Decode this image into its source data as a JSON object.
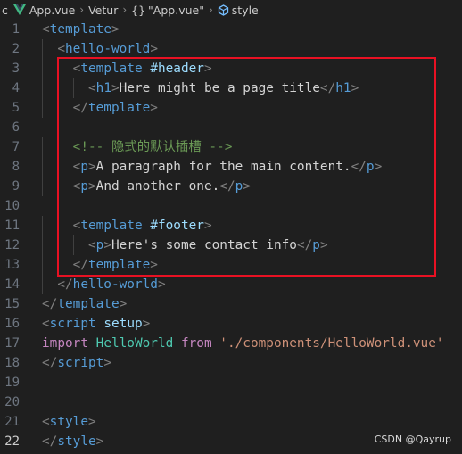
{
  "breadcrumb": {
    "items": [
      "c",
      "App.vue",
      "Vetur",
      "\"App.vue\"",
      "style"
    ],
    "braces": "{}",
    "separator": "›"
  },
  "lines": [
    {
      "n": "1",
      "tokens": [
        [
          "bracket",
          "<"
        ],
        [
          "tag",
          "template"
        ],
        [
          "bracket",
          ">"
        ]
      ]
    },
    {
      "n": "2",
      "tokens": [
        [
          "text",
          "  "
        ],
        [
          "bracket",
          "<"
        ],
        [
          "tag",
          "hello-world"
        ],
        [
          "bracket",
          ">"
        ]
      ]
    },
    {
      "n": "3",
      "tokens": [
        [
          "text",
          "    "
        ],
        [
          "bracket",
          "<"
        ],
        [
          "tag",
          "template"
        ],
        [
          "text",
          " "
        ],
        [
          "attr",
          "#header"
        ],
        [
          "bracket",
          ">"
        ]
      ]
    },
    {
      "n": "4",
      "tokens": [
        [
          "text",
          "      "
        ],
        [
          "bracket",
          "<"
        ],
        [
          "tag",
          "h1"
        ],
        [
          "bracket",
          ">"
        ],
        [
          "text",
          "Here might be a page title"
        ],
        [
          "bracket",
          "</"
        ],
        [
          "tag",
          "h1"
        ],
        [
          "bracket",
          ">"
        ]
      ]
    },
    {
      "n": "5",
      "tokens": [
        [
          "text",
          "    "
        ],
        [
          "bracket",
          "</"
        ],
        [
          "tag",
          "template"
        ],
        [
          "bracket",
          ">"
        ]
      ]
    },
    {
      "n": "6",
      "tokens": []
    },
    {
      "n": "7",
      "tokens": [
        [
          "text",
          "    "
        ],
        [
          "comment",
          "<!-- 隐式的默认插槽 -->"
        ]
      ]
    },
    {
      "n": "8",
      "tokens": [
        [
          "text",
          "    "
        ],
        [
          "bracket",
          "<"
        ],
        [
          "tag",
          "p"
        ],
        [
          "bracket",
          ">"
        ],
        [
          "text",
          "A paragraph for the main content."
        ],
        [
          "bracket",
          "</"
        ],
        [
          "tag",
          "p"
        ],
        [
          "bracket",
          ">"
        ]
      ]
    },
    {
      "n": "9",
      "tokens": [
        [
          "text",
          "    "
        ],
        [
          "bracket",
          "<"
        ],
        [
          "tag",
          "p"
        ],
        [
          "bracket",
          ">"
        ],
        [
          "text",
          "And another one."
        ],
        [
          "bracket",
          "</"
        ],
        [
          "tag",
          "p"
        ],
        [
          "bracket",
          ">"
        ]
      ]
    },
    {
      "n": "10",
      "tokens": []
    },
    {
      "n": "11",
      "tokens": [
        [
          "text",
          "    "
        ],
        [
          "bracket",
          "<"
        ],
        [
          "tag",
          "template"
        ],
        [
          "text",
          " "
        ],
        [
          "attr",
          "#footer"
        ],
        [
          "bracket",
          ">"
        ]
      ]
    },
    {
      "n": "12",
      "tokens": [
        [
          "text",
          "      "
        ],
        [
          "bracket",
          "<"
        ],
        [
          "tag",
          "p"
        ],
        [
          "bracket",
          ">"
        ],
        [
          "text",
          "Here's some contact info"
        ],
        [
          "bracket",
          "</"
        ],
        [
          "tag",
          "p"
        ],
        [
          "bracket",
          ">"
        ]
      ]
    },
    {
      "n": "13",
      "tokens": [
        [
          "text",
          "    "
        ],
        [
          "bracket",
          "</"
        ],
        [
          "tag",
          "template"
        ],
        [
          "bracket",
          ">"
        ]
      ]
    },
    {
      "n": "14",
      "tokens": [
        [
          "text",
          "  "
        ],
        [
          "bracket",
          "</"
        ],
        [
          "tag",
          "hello-world"
        ],
        [
          "bracket",
          ">"
        ]
      ]
    },
    {
      "n": "15",
      "tokens": [
        [
          "bracket",
          "</"
        ],
        [
          "tag",
          "template"
        ],
        [
          "bracket",
          ">"
        ]
      ]
    },
    {
      "n": "16",
      "tokens": [
        [
          "bracket",
          "<"
        ],
        [
          "tag",
          "script"
        ],
        [
          "text",
          " "
        ],
        [
          "attr",
          "setup"
        ],
        [
          "bracket",
          ">"
        ]
      ]
    },
    {
      "n": "17",
      "tokens": [
        [
          "keyword",
          "import"
        ],
        [
          "text",
          " "
        ],
        [
          "class",
          "HelloWorld"
        ],
        [
          "text",
          " "
        ],
        [
          "keyword",
          "from"
        ],
        [
          "text",
          " "
        ],
        [
          "string",
          "'./components/HelloWorld.vue'"
        ]
      ]
    },
    {
      "n": "18",
      "tokens": [
        [
          "bracket",
          "</"
        ],
        [
          "tag",
          "script"
        ],
        [
          "bracket",
          ">"
        ]
      ]
    },
    {
      "n": "19",
      "tokens": []
    },
    {
      "n": "20",
      "tokens": []
    },
    {
      "n": "21",
      "tokens": [
        [
          "bracket",
          "<"
        ],
        [
          "tag",
          "style"
        ],
        [
          "bracket",
          ">"
        ]
      ]
    },
    {
      "n": "22",
      "tokens": [
        [
          "bracket",
          "</"
        ],
        [
          "tag",
          "style"
        ],
        [
          "bracket",
          ">"
        ]
      ]
    }
  ],
  "active_line": "22",
  "watermark": "CSDN @Qayrup",
  "colors": {
    "background": "#1f1f1f",
    "highlight_box": "#e81123",
    "tag": "#569cd6",
    "bracket": "#808080",
    "attr": "#9cdcfe",
    "comment": "#6a9955",
    "keyword": "#c586c0",
    "class": "#4ec9b0",
    "string": "#ce9178",
    "vue_logo": "#41b883"
  },
  "icons": [
    "vue-logo-icon",
    "symbol-icon"
  ]
}
